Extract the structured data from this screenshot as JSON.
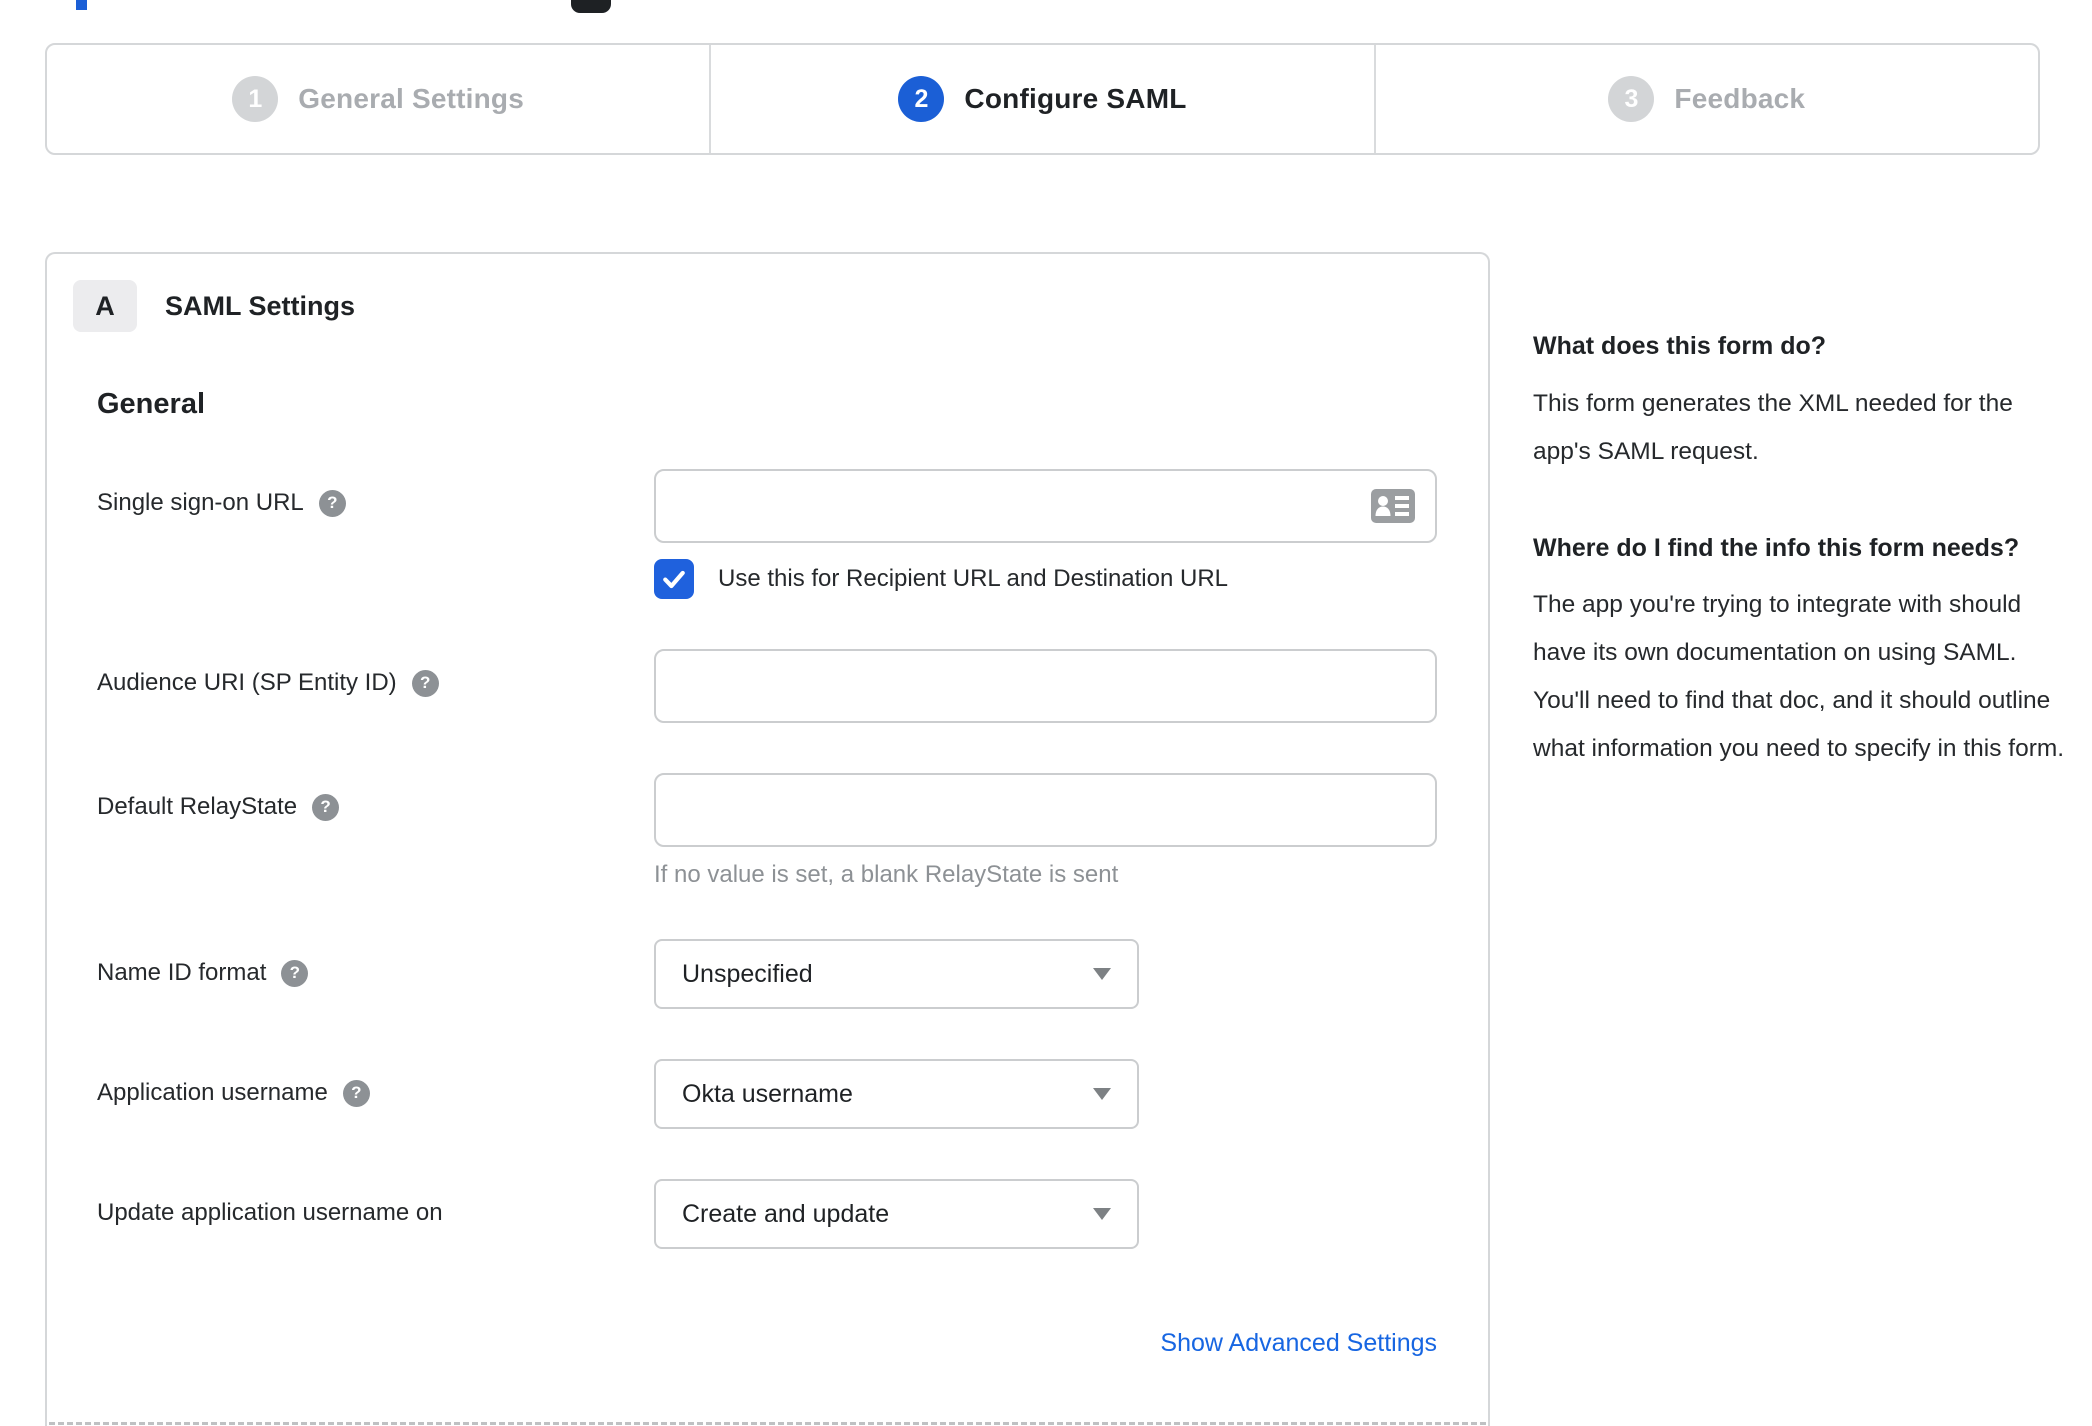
{
  "stepper": {
    "steps": [
      {
        "number": "1",
        "label": "General Settings",
        "state": "inactive"
      },
      {
        "number": "2",
        "label": "Configure SAML",
        "state": "active"
      },
      {
        "number": "3",
        "label": "Feedback",
        "state": "inactive"
      }
    ]
  },
  "panel": {
    "badge": "A",
    "title": "SAML Settings",
    "section": "General",
    "fields": {
      "sso": {
        "label": "Single sign-on URL",
        "value": "",
        "checkbox_label": "Use this for Recipient URL and Destination URL",
        "checked": true
      },
      "audience": {
        "label": "Audience URI (SP Entity ID)",
        "value": ""
      },
      "relay": {
        "label": "Default RelayState",
        "value": "",
        "hint": "If no value is set, a blank RelayState is sent"
      },
      "name_id_format": {
        "label": "Name ID format",
        "value": "Unspecified"
      },
      "app_username": {
        "label": "Application username",
        "value": "Okta username"
      },
      "update_username": {
        "label": "Update application username on",
        "value": "Create and update"
      }
    },
    "advanced_link": "Show Advanced Settings"
  },
  "sidebar": {
    "heading1": "What does this form do?",
    "body1": "This form generates the XML needed for the app's SAML request.",
    "heading2": "Where do I find the info this form needs?",
    "body2": "The app you're trying to integrate with should have its own documentation on using SAML. You'll need to find that doc, and it should outline what information you need to specify in this form."
  },
  "icons": {
    "help": "?"
  },
  "colors": {
    "accent_blue": "#1b5fd6",
    "checkbox_blue": "#1f61dd",
    "link_blue": "#1766e2",
    "inactive_gray": "#a9acb0",
    "border_gray": "#d5d7d9",
    "hint_gray": "#8d9195"
  }
}
